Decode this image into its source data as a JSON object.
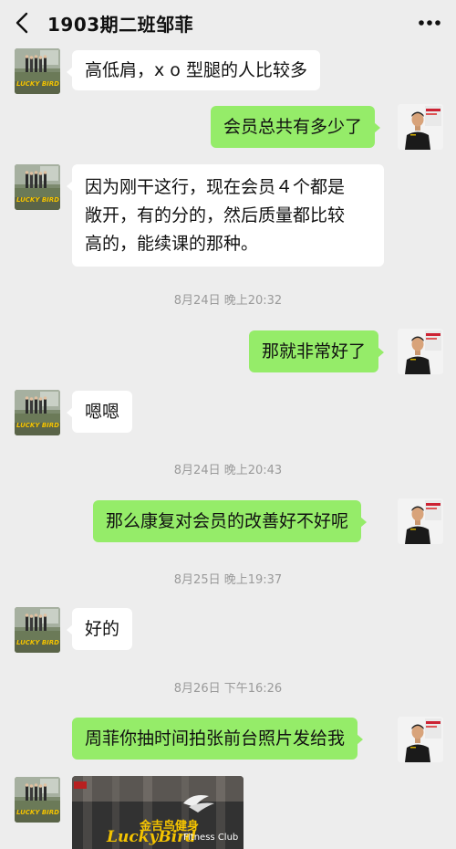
{
  "header": {
    "title": "1903期二班邹菲",
    "back_icon": "back-arrow-icon",
    "more_icon": "more-options-icon"
  },
  "avatars": {
    "left": {
      "logo_text": "LUCKY BIRD"
    }
  },
  "messages": [
    {
      "side": "left",
      "text": "高低肩，x o 型腿的人比较多"
    },
    {
      "side": "right",
      "text": "会员总共有多少了"
    },
    {
      "side": "left",
      "lines": [
        "因为刚干这行，现在会员４个都是",
        "敞开，有的分的，然后质量都比较",
        "高的，能续课的那种。"
      ]
    },
    {
      "side": "right",
      "text": "那就非常好了"
    },
    {
      "side": "left",
      "text": "嗯嗯"
    },
    {
      "side": "right",
      "text": "那么康复对会员的改善好不好呢"
    },
    {
      "side": "left",
      "text": "好的"
    },
    {
      "side": "right",
      "text": "周菲你抽时间拍张前台照片发给我"
    }
  ],
  "timestamps": [
    "8月24日 晚上20:32",
    "8月24日 晚上20:43",
    "8月25日 晚上19:37",
    "8月26日 下午16:26"
  ],
  "photo": {
    "chinese_text": "金吉鸟健身",
    "brand_text": "LuckyBird",
    "sub_text": "Fitness Club"
  },
  "colors": {
    "background": "#ededed",
    "right_bubble": "#95ec69",
    "left_bubble": "#ffffff",
    "timestamp": "#9a9a9a"
  }
}
